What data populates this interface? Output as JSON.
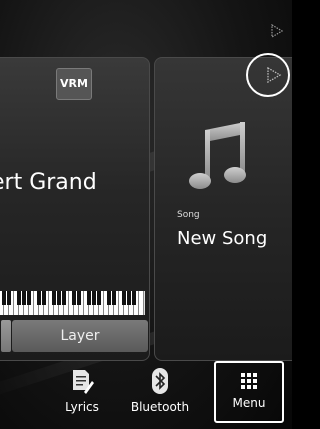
{
  "voice": {
    "badge": "VRM",
    "name": "ert Grand",
    "layer_label": "Layer"
  },
  "song": {
    "type_label": "Song",
    "name": "New Song"
  },
  "bottom_bar": {
    "lyrics_label": "Lyrics",
    "bluetooth_label": "Bluetooth",
    "menu_label": "Menu"
  },
  "icons": [
    "arrow-right-icon",
    "music-note-icon",
    "lyrics-icon",
    "bluetooth-icon",
    "menu-grid-icon"
  ]
}
